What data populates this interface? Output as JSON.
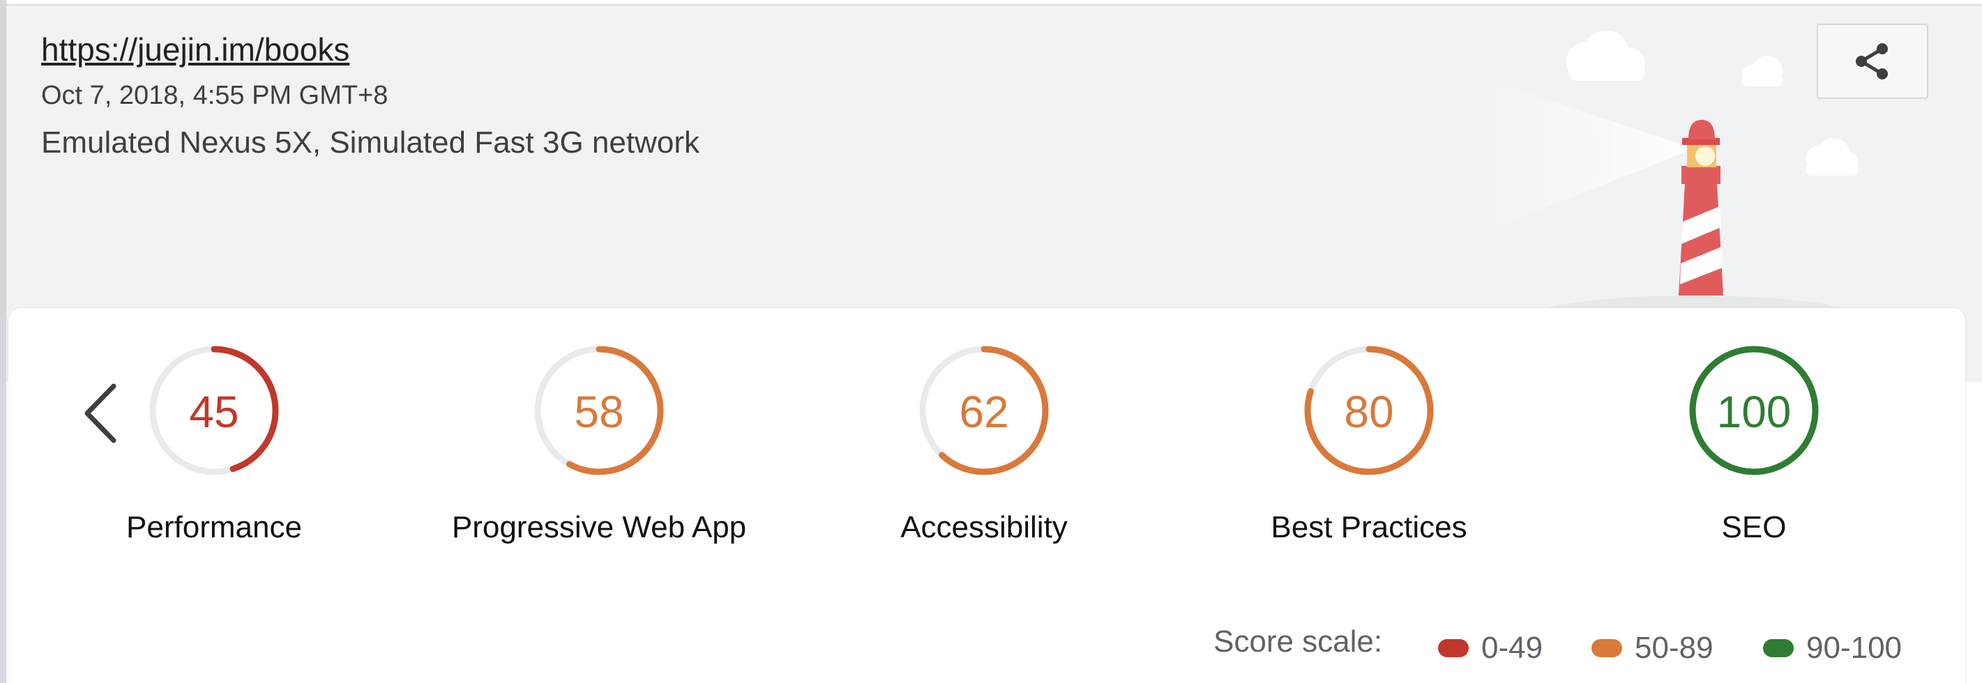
{
  "report": {
    "url": "https://juejin.im/books",
    "timestamp": "Oct 7, 2018, 4:55 PM GMT+8",
    "environment": "Emulated Nexus 5X, Simulated Fast 3G network"
  },
  "icons": {
    "share": "share-icon",
    "previous": "chevron-left-icon",
    "illustration": "lighthouse-illustration"
  },
  "colors": {
    "fail": "#c0392b",
    "average": "#d9793a",
    "pass": "#2e7d32",
    "track": "#e8eaed",
    "header_bg": "#f1f2f4"
  },
  "gauges": [
    {
      "label": "Performance",
      "score": "45",
      "value": 0.45,
      "status": "fail"
    },
    {
      "label": "Progressive Web App",
      "score": "58",
      "value": 0.58,
      "status": "average"
    },
    {
      "label": "Accessibility",
      "score": "62",
      "value": 0.62,
      "status": "average"
    },
    {
      "label": "Best Practices",
      "score": "80",
      "value": 0.8,
      "status": "average"
    },
    {
      "label": "SEO",
      "score": "100",
      "value": 1.0,
      "status": "pass"
    }
  ],
  "scale": {
    "title": "Score scale:",
    "ranges": [
      {
        "label": "0-49",
        "status": "fail"
      },
      {
        "label": "50-89",
        "status": "average"
      },
      {
        "label": "90-100",
        "status": "pass"
      }
    ]
  }
}
